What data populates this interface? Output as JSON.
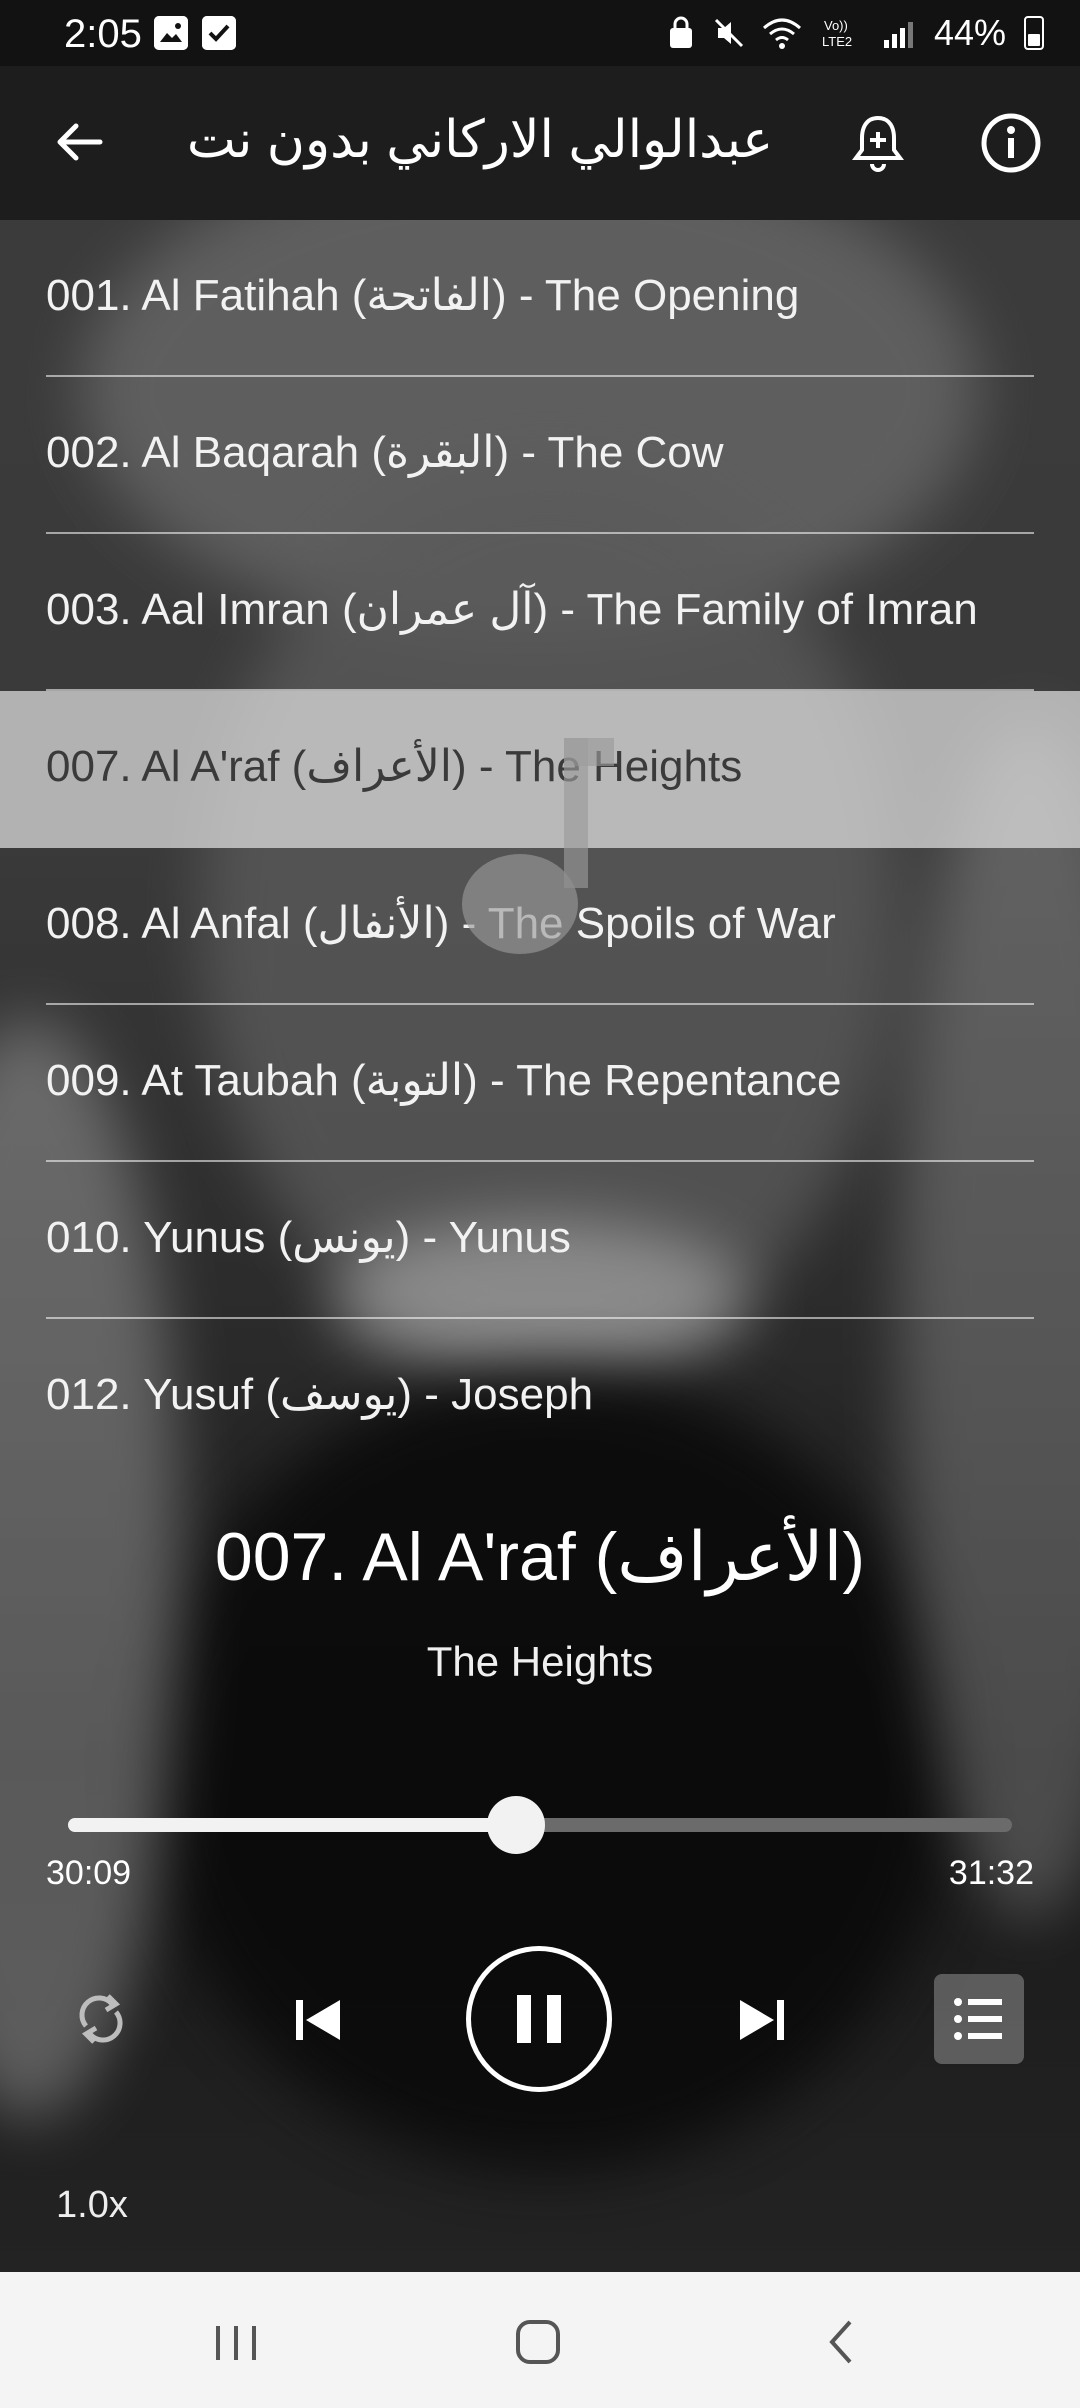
{
  "status_bar": {
    "time": "2:05",
    "battery": "44%"
  },
  "app_bar": {
    "title": "عبدالوالي الاركاني بدون نت",
    "back_icon": "arrow-left-icon",
    "bell_icon": "bell-plus-icon",
    "info_icon": "info-icon"
  },
  "tracks": [
    {
      "label": "001. Al Fatihah (الفاتحة) - The Opening",
      "selected": false
    },
    {
      "label": "002. Al Baqarah (البقرة) - The Cow",
      "selected": false
    },
    {
      "label": "003. Aal Imran (آل عمران) - The Family of Imran",
      "selected": false
    },
    {
      "label": "007. Al A'raf (الأعراف) - The Heights",
      "selected": true
    },
    {
      "label": "008. Al Anfal (الأنفال) - The Spoils of War",
      "selected": false
    },
    {
      "label": "009. At Taubah (التوبة) - The Repentance",
      "selected": false
    },
    {
      "label": "010. Yunus (يونس) - Yunus",
      "selected": false
    },
    {
      "label": "012. Yusuf (يوسف) - Joseph",
      "selected": false
    }
  ],
  "now_playing": {
    "title": "007. Al A'raf (الأعراف)",
    "subtitle": "The Heights",
    "elapsed": "30:09",
    "total": "31:32",
    "progress_fraction": 0.475,
    "speed": "1.0x"
  },
  "colors": {
    "app_bar": "#1d1d1d",
    "status_bar": "#121212",
    "selected_row": "#e1e1e1",
    "nav_bar": "#f4f4f4"
  }
}
